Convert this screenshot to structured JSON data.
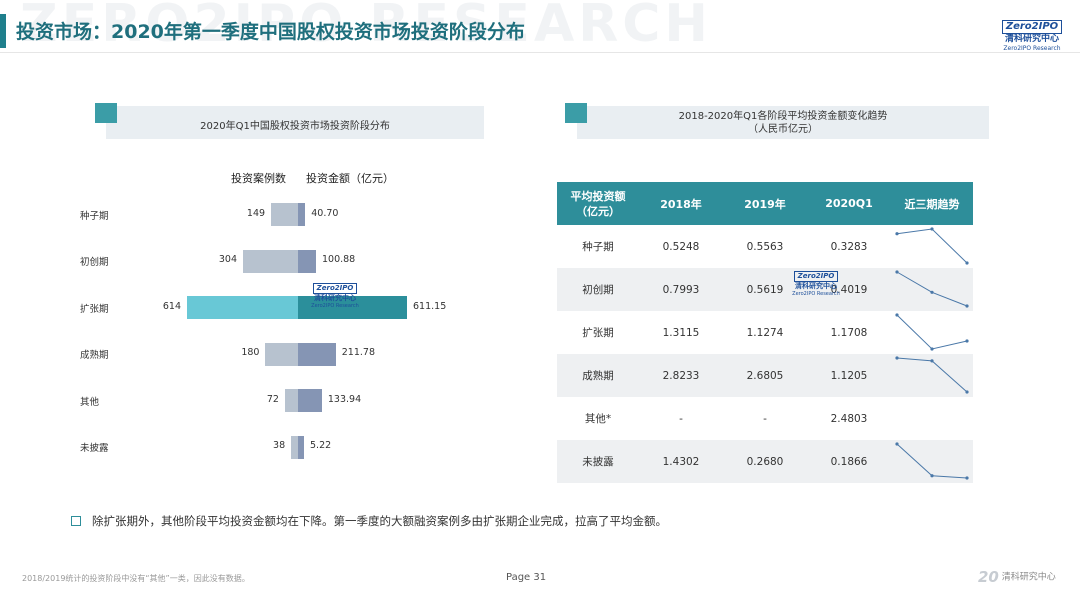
{
  "header": {
    "title": "投资市场：2020年第一季度中国股权投资市场投资阶段分布",
    "watermark": "ZERO2IPO RESEARCH",
    "logo_box": "Zero2IPO",
    "logo_cn": "清科研究中心",
    "logo_en": "Zero2IPO Research"
  },
  "left_panel": {
    "title": "2020年Q1中国股权投资市场投资阶段分布",
    "col_cases": "投资案例数",
    "col_amount": "投资金额（亿元）"
  },
  "chart_data": {
    "type": "bar",
    "orientation": "horizontal-butterfly",
    "title": "2020年Q1中国股权投资市场投资阶段分布",
    "categories": [
      "种子期",
      "初创期",
      "扩张期",
      "成熟期",
      "其他",
      "未披露"
    ],
    "series": [
      {
        "name": "投资案例数",
        "values": [
          149,
          304,
          614,
          180,
          72,
          38
        ],
        "labels": [
          "149",
          "304",
          "614",
          "180",
          "72",
          "38"
        ],
        "color": "#b7c2cf",
        "highlight_color": "#68c8d6"
      },
      {
        "name": "投资金额（亿元）",
        "values": [
          40.7,
          100.88,
          611.15,
          211.78,
          133.94,
          5.22
        ],
        "labels": [
          "40.70",
          "100.88",
          "611.15",
          "211.78",
          "133.94",
          "5.22"
        ],
        "color": "#8595b4",
        "highlight_color": "#2b8f9b"
      }
    ],
    "highlight_index": 2
  },
  "right_panel": {
    "title_line1": "2018-2020年Q1各阶段平均投资金额变化趋势",
    "title_line2": "（人民币亿元）"
  },
  "table": {
    "headers": [
      "平均投资额\n（亿元）",
      "2018年",
      "2019年",
      "2020Q1",
      "近三期趋势"
    ],
    "rows": [
      {
        "label": "种子期",
        "v2018": "0.5248",
        "v2019": "0.5563",
        "v2020": "0.3283",
        "trend": [
          0.5248,
          0.5563,
          0.3283
        ]
      },
      {
        "label": "初创期",
        "v2018": "0.7993",
        "v2019": "0.5619",
        "v2020": "0.4019",
        "trend": [
          0.7993,
          0.5619,
          0.4019
        ]
      },
      {
        "label": "扩张期",
        "v2018": "1.3115",
        "v2019": "1.1274",
        "v2020": "1.1708",
        "trend": [
          1.3115,
          1.1274,
          1.1708
        ]
      },
      {
        "label": "成熟期",
        "v2018": "2.8233",
        "v2019": "2.6805",
        "v2020": "1.1205",
        "trend": [
          2.8233,
          2.6805,
          1.1205
        ]
      },
      {
        "label": "其他*",
        "v2018": "-",
        "v2019": "-",
        "v2020": "2.4803",
        "trend": null
      },
      {
        "label": "未披露",
        "v2018": "1.4302",
        "v2019": "0.2680",
        "v2020": "0.1866",
        "trend": [
          1.4302,
          0.268,
          0.1866
        ]
      }
    ],
    "trend_color": "#4a78a8"
  },
  "note": "除扩张期外，其他阶段平均投资金额均在下降。第一季度的大额融资案例多由扩张期企业完成，拉高了平均金额。",
  "footer": {
    "footnote": "2018/2019统计的投资阶段中没有“其他”一类，因此没有数据。",
    "page": "Page  31",
    "logo_num": "20",
    "logo_text": "清科研究中心"
  }
}
